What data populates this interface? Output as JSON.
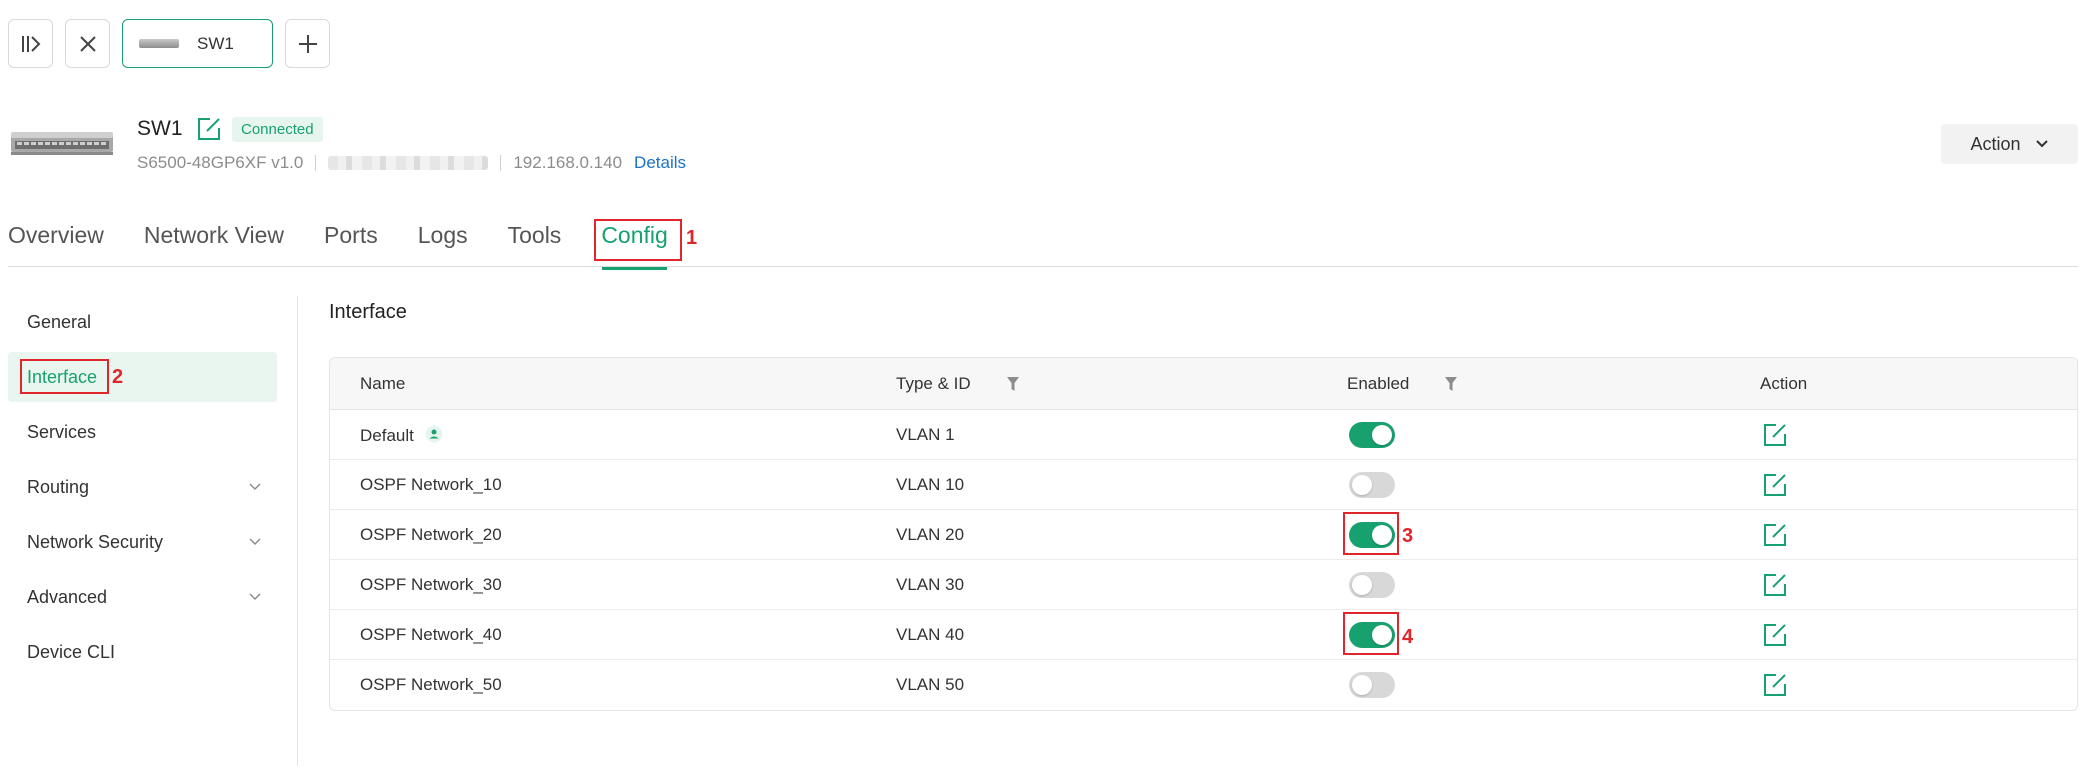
{
  "toolbar": {
    "open_tab_label": "SW1"
  },
  "device": {
    "name": "SW1",
    "status": "Connected",
    "model": "S6500-48GP6XF v1.0",
    "ip": "192.168.0.140",
    "details_label": "Details",
    "action_label": "Action"
  },
  "tabs": [
    {
      "label": "Overview"
    },
    {
      "label": "Network View"
    },
    {
      "label": "Ports"
    },
    {
      "label": "Logs"
    },
    {
      "label": "Tools"
    },
    {
      "label": "Config",
      "active": true
    }
  ],
  "sidebar": {
    "items": [
      {
        "label": "General"
      },
      {
        "label": "Interface",
        "active": true
      },
      {
        "label": "Services"
      },
      {
        "label": "Routing",
        "expandable": true
      },
      {
        "label": "Network Security",
        "expandable": true
      },
      {
        "label": "Advanced",
        "expandable": true
      },
      {
        "label": "Device CLI"
      }
    ]
  },
  "content": {
    "title": "Interface",
    "columns": {
      "name": "Name",
      "type_id": "Type & ID",
      "enabled": "Enabled",
      "action": "Action"
    },
    "rows": [
      {
        "name": "Default",
        "type_id": "VLAN 1",
        "enabled": true
      },
      {
        "name": "OSPF Network_10",
        "type_id": "VLAN 10",
        "enabled": false
      },
      {
        "name": "OSPF Network_20",
        "type_id": "VLAN 20",
        "enabled": true
      },
      {
        "name": "OSPF Network_30",
        "type_id": "VLAN 30",
        "enabled": false
      },
      {
        "name": "OSPF Network_40",
        "type_id": "VLAN 40",
        "enabled": true
      },
      {
        "name": "OSPF Network_50",
        "type_id": "VLAN 50",
        "enabled": false
      }
    ]
  },
  "annotations": {
    "n1": "1",
    "n2": "2",
    "n3": "3",
    "n4": "4"
  },
  "colors": {
    "accent": "#17a16e",
    "annotation": "#e0262b",
    "link": "#1a73c8"
  }
}
